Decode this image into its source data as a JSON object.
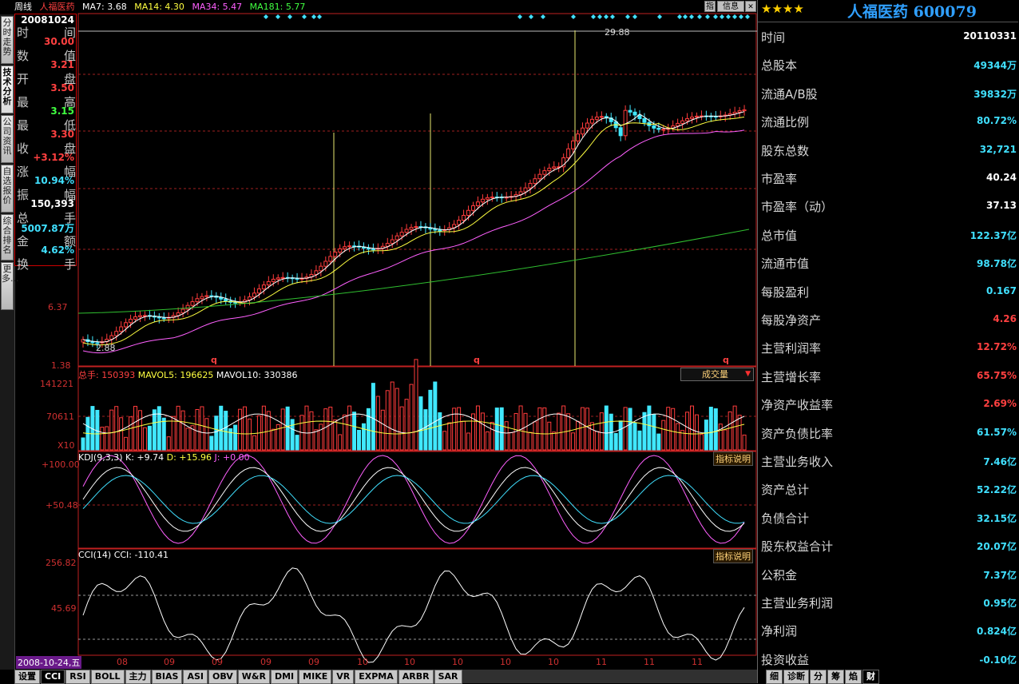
{
  "topbar": {
    "period": "周线",
    "stock_name": "人福医药",
    "ma7": "MA7: 3.68",
    "ma14": "MA14: 4.30",
    "ma34": "MA34: 5.47",
    "ma181": "MA181: 5.77",
    "btn_index": "指",
    "btn_info": "信息"
  },
  "left_tabs": [
    "分时走势",
    "技术分析",
    "公司资讯",
    "自选报价",
    "综合排名",
    "更多..."
  ],
  "databox": {
    "rows": [
      {
        "l": "时",
        "r": "间",
        "v": "20081024",
        "c": "#ffffff"
      },
      {
        "l": "数",
        "r": "值",
        "v": "30.00",
        "c": "#ff4040"
      },
      {
        "l": "开",
        "r": "盘",
        "v": "3.21",
        "c": "#ff4040"
      },
      {
        "l": "最",
        "r": "高",
        "v": "3.50",
        "c": "#ff4040"
      },
      {
        "l": "最",
        "r": "低",
        "v": "3.15",
        "c": "#40ff40"
      },
      {
        "l": "收",
        "r": "盘",
        "v": "3.30",
        "c": "#ff4040"
      },
      {
        "l": "涨",
        "r": "幅",
        "v": "+3.12%",
        "c": "#ff4040"
      },
      {
        "l": "振",
        "r": "幅",
        "v": "10.94%",
        "c": "#40e0ff"
      },
      {
        "l": "总",
        "r": "手",
        "v": "150,393",
        "c": "#ffffff"
      },
      {
        "l": "金",
        "r": "额",
        "v": "5007.87万",
        "c": "#40e0ff"
      },
      {
        "l": "换",
        "r": "手",
        "v": "4.62%",
        "c": "#40e0ff"
      }
    ]
  },
  "main_chart": {
    "ylabels": [
      "6.37",
      "1.38"
    ],
    "high_marker": "29.88",
    "low_marker": "2.88",
    "q_marker": "q"
  },
  "volume_panel": {
    "total": "总手: 150393",
    "mavol5": "MAVOL5: 196625",
    "mavol10": "MAVOL10: 330386",
    "dropdown": "成交量",
    "ylabels": [
      "141221",
      "70611",
      "X10"
    ]
  },
  "kdj_panel": {
    "title": "KDJ(9,3,3)",
    "k": "K: +9.74",
    "d": "D: +15.96",
    "j": "J: +0.00",
    "info": "指标说明",
    "ylabels": [
      "+100.00",
      "+50.48"
    ]
  },
  "cci_panel": {
    "title": "CCI(14)",
    "cci": "CCI: -110.41",
    "info": "指标说明",
    "ylabels": [
      "256.82",
      "45.69"
    ]
  },
  "xaxis": {
    "date": "2008-10-24,五",
    "months": [
      "08",
      "09",
      "09",
      "09",
      "09",
      "10",
      "10",
      "10",
      "10",
      "10",
      "11",
      "11",
      "11"
    ]
  },
  "bottom_tabs": [
    "设置",
    "CCI",
    "RSI",
    "BOLL",
    "主力",
    "BIAS",
    "ASI",
    "OBV",
    "W&R",
    "DMI",
    "MIKE",
    "VR",
    "EXPMA",
    "ARBR",
    "SAR"
  ],
  "right_panel": {
    "stars": "★★★★",
    "title": "人福医药 600079",
    "rows": [
      {
        "l": "时间",
        "v": "20110331",
        "c": "#ffffff"
      },
      {
        "l": "总股本",
        "v": "49344万",
        "c": "#40e0ff"
      },
      {
        "l": "流通A/B股",
        "v": "39832万",
        "c": "#40e0ff"
      },
      {
        "l": "流通比例",
        "v": "80.72%",
        "c": "#40e0ff"
      },
      {
        "l": "股东总数",
        "v": "32,721",
        "c": "#40e0ff"
      },
      {
        "l": "市盈率",
        "v": "40.24",
        "c": "#ffffff"
      },
      {
        "l": "市盈率（动）",
        "v": "37.13",
        "c": "#ffffff"
      },
      {
        "l": "总市值",
        "v": "122.37亿",
        "c": "#40e0ff"
      },
      {
        "l": "流通市值",
        "v": "98.78亿",
        "c": "#40e0ff"
      },
      {
        "l": "每股盈利",
        "v": "0.167",
        "c": "#40e0ff"
      },
      {
        "l": "每股净资产",
        "v": "4.26",
        "c": "#ff4040"
      },
      {
        "l": "主营利润率",
        "v": "12.72%",
        "c": "#ff4040"
      },
      {
        "l": "主营增长率",
        "v": "65.75%",
        "c": "#ff4040"
      },
      {
        "l": "净资产收益率",
        "v": "2.69%",
        "c": "#ff4040"
      },
      {
        "l": "资产负债比率",
        "v": "61.57%",
        "c": "#40e0ff"
      },
      {
        "l": "主营业务收入",
        "v": "7.46亿",
        "c": "#40e0ff"
      },
      {
        "l": "资产总计",
        "v": "52.22亿",
        "c": "#40e0ff"
      },
      {
        "l": "负债合计",
        "v": "32.15亿",
        "c": "#40e0ff"
      },
      {
        "l": "股东权益合计",
        "v": "20.07亿",
        "c": "#40e0ff"
      },
      {
        "l": "公积金",
        "v": "7.37亿",
        "c": "#40e0ff"
      },
      {
        "l": "主营业务利润",
        "v": "0.95亿",
        "c": "#40e0ff"
      },
      {
        "l": "净利润",
        "v": "0.824亿",
        "c": "#40e0ff"
      },
      {
        "l": "投资收益",
        "v": "-0.10亿",
        "c": "#40e0ff"
      }
    ],
    "tabs": [
      "细",
      "诊断",
      "分",
      "筹",
      "焰",
      "财"
    ]
  }
}
